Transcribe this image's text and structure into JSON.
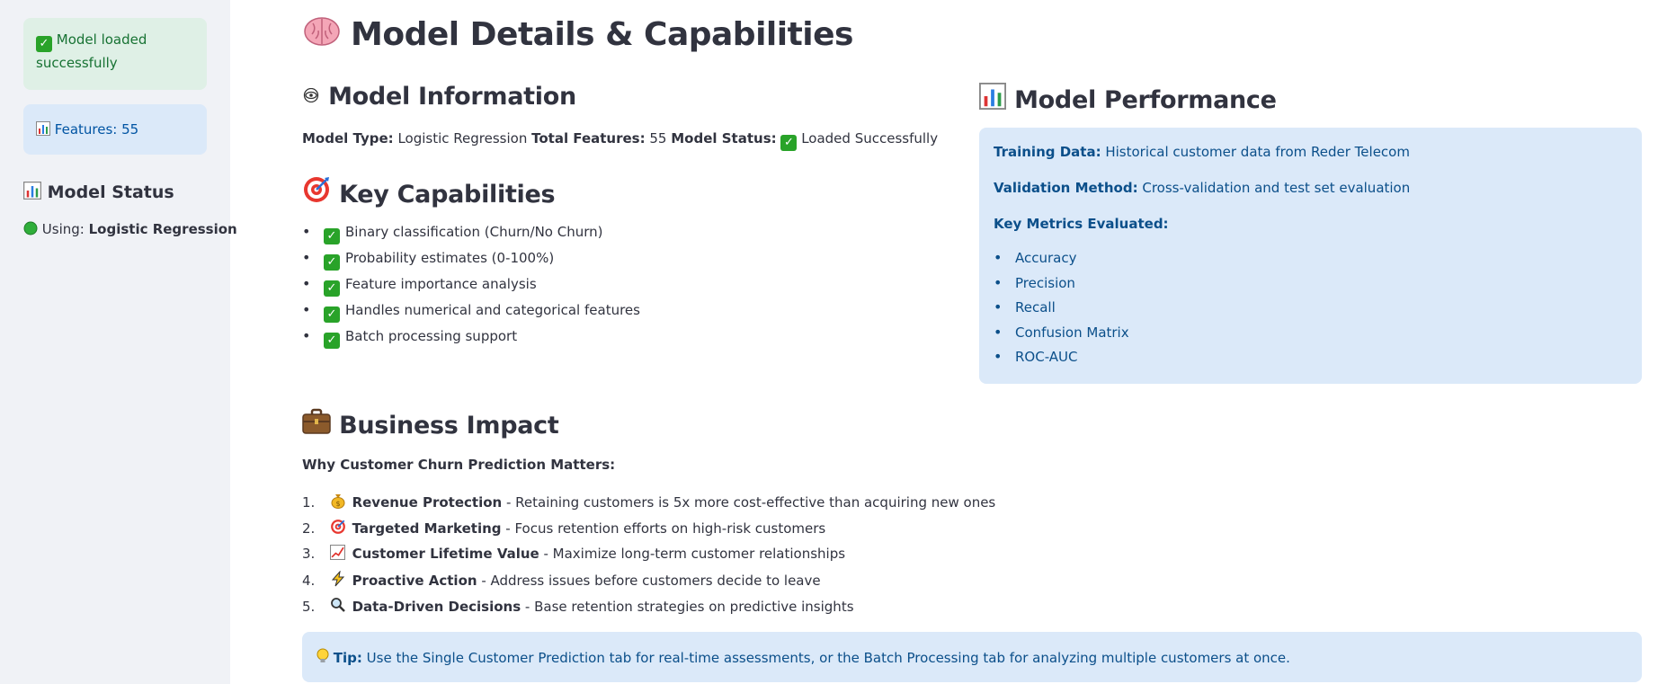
{
  "sidebar": {
    "success_alert": "Model loaded successfully",
    "features_alert": "Features: 55",
    "status_heading": "Model Status",
    "using_label": "Using:",
    "using_value": "Logistic Regression"
  },
  "main": {
    "title": "Model Details & Capabilities",
    "model_info": {
      "heading": "Model Information",
      "type_label": "Model Type:",
      "type_value": "Logistic Regression",
      "features_label": "Total Features:",
      "features_value": "55",
      "status_label": "Model Status:",
      "status_value": "Loaded Successfully"
    },
    "capabilities": {
      "heading": "Key Capabilities",
      "items": [
        "Binary classification (Churn/No Churn)",
        "Probability estimates (0-100%)",
        "Feature importance analysis",
        "Handles numerical and categorical features",
        "Batch processing support"
      ]
    },
    "performance": {
      "heading": "Model Performance",
      "training_label": "Training Data:",
      "training_value": "Historical customer data from Reder Telecom",
      "validation_label": "Validation Method:",
      "validation_value": "Cross-validation and test set evaluation",
      "metrics_label": "Key Metrics Evaluated:",
      "metrics": [
        "Accuracy",
        "Precision",
        "Recall",
        "Confusion Matrix",
        "ROC-AUC"
      ]
    },
    "business": {
      "heading": "Business Impact",
      "subheading": "Why Customer Churn Prediction Matters:",
      "items": [
        {
          "num": "1.",
          "icon": "money-bag-icon",
          "title": "Revenue Protection",
          "desc": " - Retaining customers is 5x more cost-effective than acquiring new ones"
        },
        {
          "num": "2.",
          "icon": "target-icon",
          "title": "Targeted Marketing",
          "desc": " - Focus retention efforts on high-risk customers"
        },
        {
          "num": "3.",
          "icon": "chart-up-icon",
          "title": "Customer Lifetime Value",
          "desc": " - Maximize long-term customer relationships"
        },
        {
          "num": "4.",
          "icon": "lightning-icon",
          "title": "Proactive Action",
          "desc": " - Address issues before customers decide to leave"
        },
        {
          "num": "5.",
          "icon": "magnifier-icon",
          "title": "Data-Driven Decisions",
          "desc": " - Base retention strategies on predictive insights"
        }
      ]
    },
    "tip": {
      "label": "Tip:",
      "text": " Use the Single Customer Prediction tab for real-time assessments, or the Batch Processing tab for analyzing multiple customers at once."
    }
  },
  "colors": {
    "sidebar_bg": "#f0f2f6",
    "success_bg": "#dff0e6",
    "success_text": "#177233",
    "info_bg": "#dbe9f9",
    "info_text": "#0b4f8a",
    "status_green": "#29a329"
  }
}
